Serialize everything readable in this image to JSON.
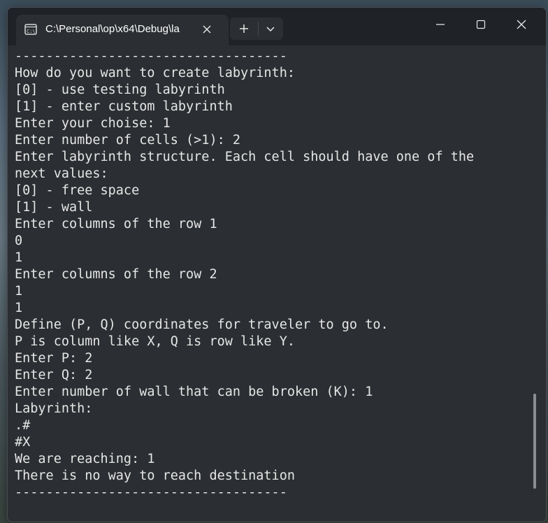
{
  "tab": {
    "title": "C:\\Personal\\op\\x64\\Debug\\la",
    "icon": "terminal-icon"
  },
  "titlebar": {
    "new_tab_icon": "plus-icon",
    "dropdown_icon": "chevron-down-icon",
    "minimize_icon": "minimize-icon",
    "maximize_icon": "maximize-icon",
    "close_icon": "close-icon"
  },
  "console": {
    "lines": [
      "-----------------------------------",
      "How do you want to create labyrinth:",
      "[0] - use testing labyrinth",
      "[1] - enter custom labyrinth",
      "Enter your choise: 1",
      "Enter number of cells (>1): 2",
      "Enter labyrinth structure. Each cell should have one of the",
      "next values:",
      "[0] - free space",
      "[1] - wall",
      "Enter columns of the row 1",
      "0",
      "1",
      "Enter columns of the row 2",
      "1",
      "1",
      "Define (P, Q) coordinates for traveler to go to.",
      "P is column like X, Q is row like Y.",
      "Enter P: 2",
      "Enter Q: 2",
      "Enter number of wall that can be broken (K): 1",
      "Labyrinth:",
      ".#",
      "#X",
      "We are reaching: 1",
      "There is no way to reach destination",
      "-----------------------------------"
    ]
  },
  "colors": {
    "background": "#2b2e32",
    "titlebar": "#1f2226",
    "text": "#e6e6e6"
  }
}
